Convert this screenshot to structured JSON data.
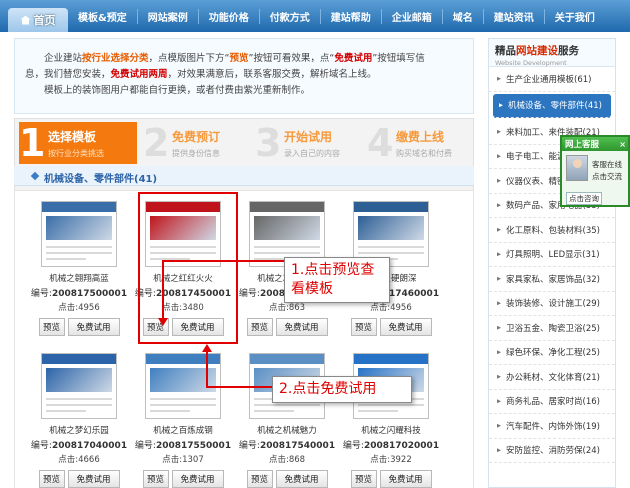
{
  "nav": {
    "home": "首页",
    "items": [
      "模板&预定",
      "网站案例",
      "功能价格",
      "付款方式",
      "建站帮助",
      "企业邮箱",
      "域名",
      "建站资讯",
      "关于我们"
    ]
  },
  "intro": {
    "line1_a": "企业建站",
    "line1_b": "按行业选择分类",
    "line1_c": "，点模版图片下方“",
    "line1_d": "预览",
    "line1_e": "”按钮可看效果，点“",
    "line1_f": "免费试用",
    "line1_g": "”按钮填写信",
    "line2_a": "息，我们替您安装，",
    "line2_b": "免费试用两周",
    "line2_c": "，对效果满意后，联系客服交费，解析域名上线。",
    "line3": "模板上的装饰图用户都能自行更换，或者付费由紫光重新制作。"
  },
  "steps": [
    {
      "num": "1",
      "title": "选择模板",
      "sub": "按行业分类挑选"
    },
    {
      "num": "2",
      "title": "免费预订",
      "sub": "提供身份信息"
    },
    {
      "num": "3",
      "title": "开始试用",
      "sub": "录入自己的内容"
    },
    {
      "num": "4",
      "title": "缴费上线",
      "sub": "购买域名和付费"
    }
  ],
  "category_title": "机械设备、零件部件(41)",
  "code_label": "编号:",
  "hits_label": "点击:",
  "btn_preview": "预览",
  "btn_trial": "免费试用",
  "templates": [
    {
      "name": "机械之翱翔高蓝",
      "code": "200817500001",
      "hits": "4956",
      "accent": "#3a6ea8"
    },
    {
      "name": "机械之红红火火",
      "code": "200817450001",
      "hits": "3480",
      "accent": "#c0141c"
    },
    {
      "name": "机械之灰色硬朗",
      "code": "200817450002",
      "hits": "863",
      "accent": "#666666"
    },
    {
      "name": "机械之硬朗深",
      "code": "200817460001",
      "hits": "4956",
      "accent": "#2d5f95"
    },
    {
      "name": "机械之梦幻乐园",
      "code": "200817040001",
      "hits": "4666",
      "accent": "#2b64a8"
    },
    {
      "name": "机械之百炼成钢",
      "code": "200817550001",
      "hits": "1307",
      "accent": "#3f7fc0"
    },
    {
      "name": "机械之机械魅力",
      "code": "200817540001",
      "hits": "868",
      "accent": "#5b8fc4"
    },
    {
      "name": "机械之闪耀科技",
      "code": "200817020001",
      "hits": "3922",
      "accent": "#2672c7"
    }
  ],
  "callout1": "1.点击预览查看模板",
  "callout1_a": "1.点击预览查",
  "callout1_b": "看模板",
  "callout2": "2.点击免费试用",
  "sidebar": {
    "title_a": "精品",
    "title_b": "网站建设",
    "title_c": "服务",
    "subtitle": "Website Development",
    "items": [
      "生产企业通用模板(61)",
      "机械设备、零件部件(41)",
      "来料加工、来件装配(21)",
      "电子电工、能源(39)",
      "仪器仪表、精密仪器(23)",
      "数码产品、家用电器(33)",
      "化工原料、包装材料(35)",
      "灯具照明、LED显示(31)",
      "家具家私、家居饰品(32)",
      "装饰装修、设计施工(29)",
      "卫浴五金、陶瓷卫浴(25)",
      "绿色环保、净化工程(25)",
      "办公耗材、文化体育(21)",
      "商务礼品、居家时尚(16)",
      "汽车配件、内饰外饰(19)",
      "安防监控、消防劳保(24)"
    ]
  },
  "service": {
    "title": "网上客服",
    "close": "×",
    "msg1": "客服在线",
    "msg2": "点击交流",
    "foot": "点击咨询"
  }
}
